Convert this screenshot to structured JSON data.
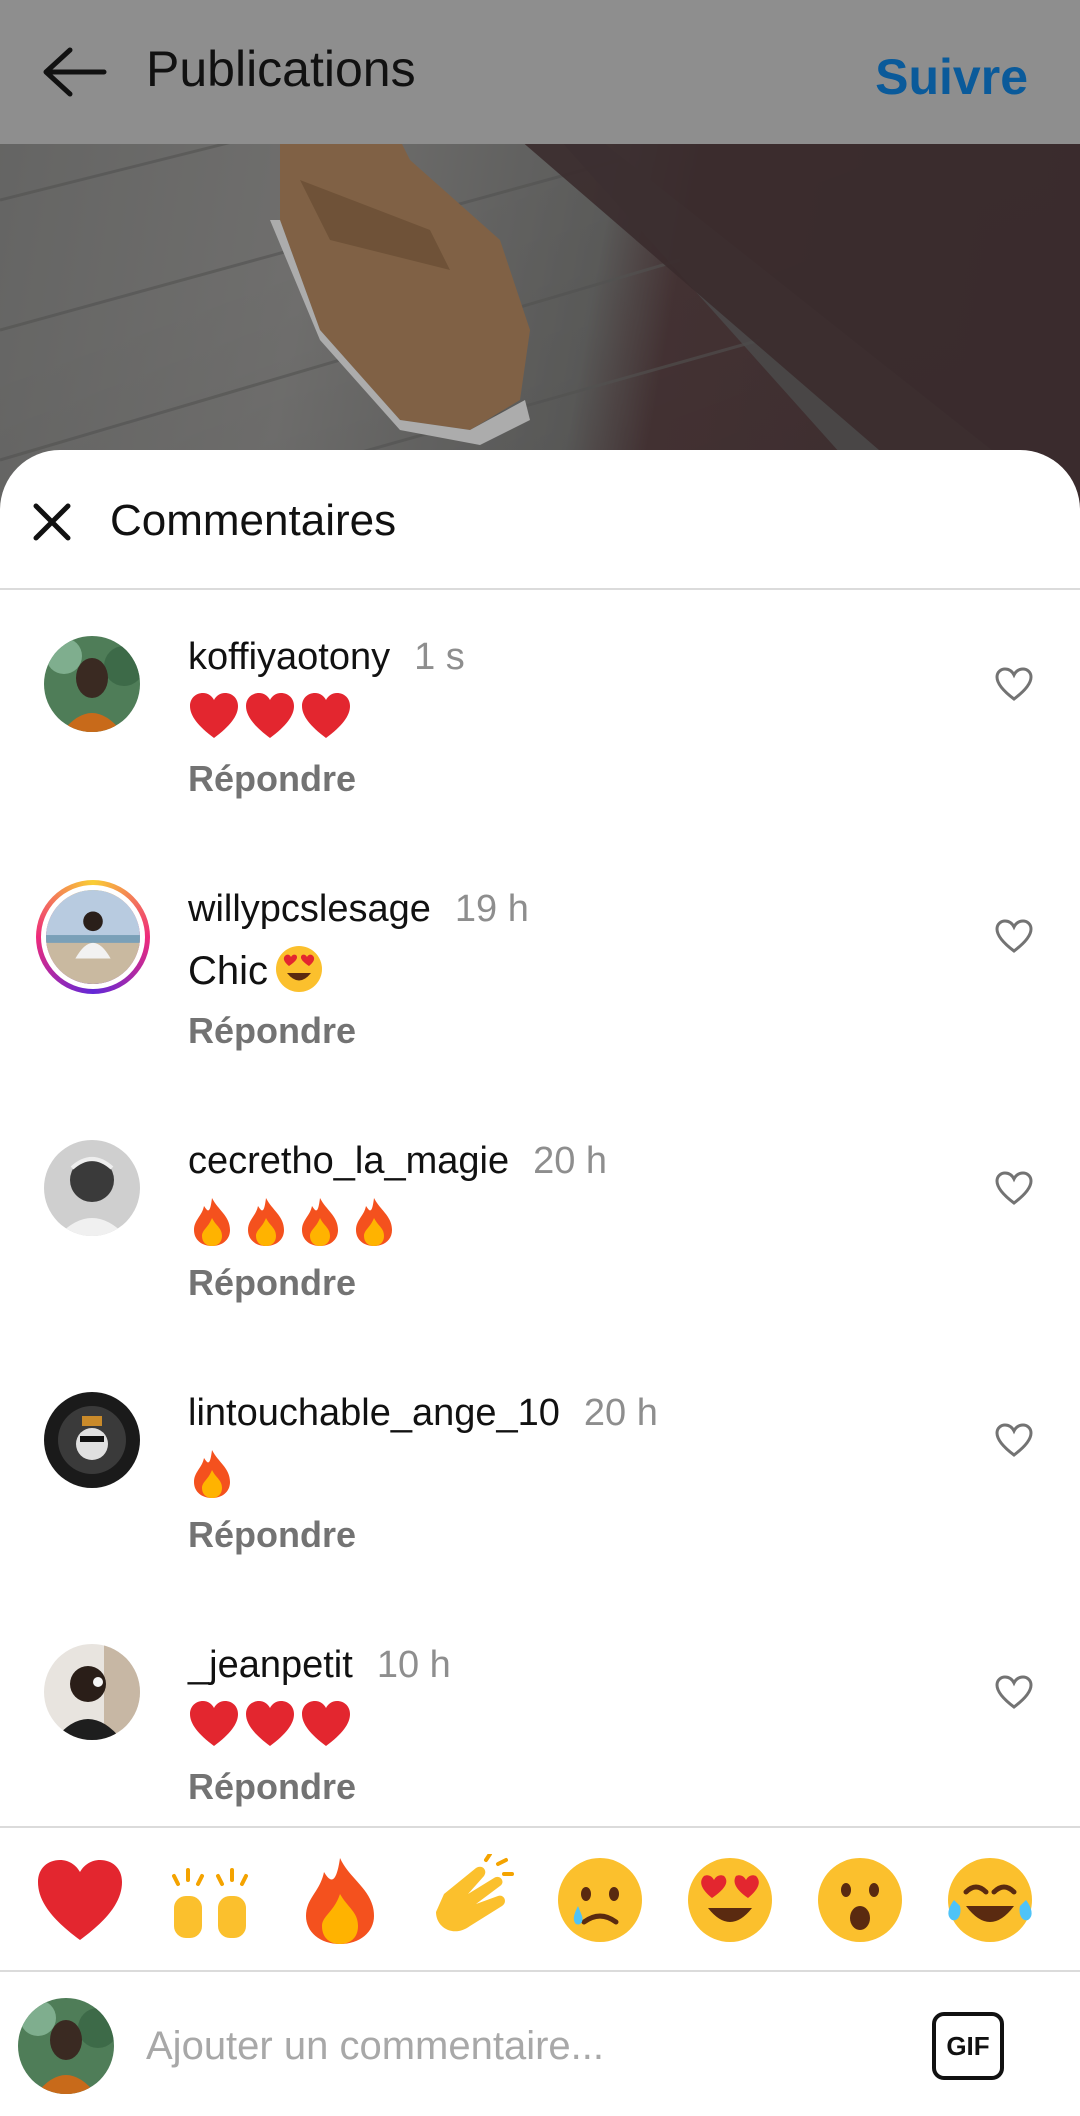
{
  "header": {
    "title": "Publications",
    "follow_label": "Suivre"
  },
  "sheet": {
    "title": "Commentaires"
  },
  "comments": [
    {
      "user": "koffiyaotony",
      "time": "1 s",
      "text": "",
      "emoji": "hearts-3",
      "reply": "Répondre"
    },
    {
      "user": "willypcslesage",
      "time": "19 h",
      "text": "Chic",
      "emoji": "heart-eyes",
      "reply": "Répondre"
    },
    {
      "user": "cecretho_la_magie",
      "time": "20 h",
      "text": "",
      "emoji": "fire-4",
      "reply": "Répondre"
    },
    {
      "user": "lintouchable_ange_10",
      "time": "20 h",
      "text": "",
      "emoji": "fire-1",
      "reply": "Répondre"
    },
    {
      "user": "_jeanpetit",
      "time": "10 h",
      "text": "",
      "emoji": "hearts-3",
      "reply": "Répondre"
    }
  ],
  "reactions": [
    "red-heart-icon",
    "raising-hands-icon",
    "fire-icon",
    "clapping-hands-icon",
    "sad-tear-face-icon",
    "heart-eyes-face-icon",
    "surprised-face-icon",
    "tears-of-joy-face-icon"
  ],
  "composer": {
    "placeholder": "Ajouter un commentaire...",
    "gif_label": "GIF"
  },
  "colors": {
    "follow": "#0a5a9a",
    "muted": "#8e8e8e",
    "reply": "#737373"
  }
}
